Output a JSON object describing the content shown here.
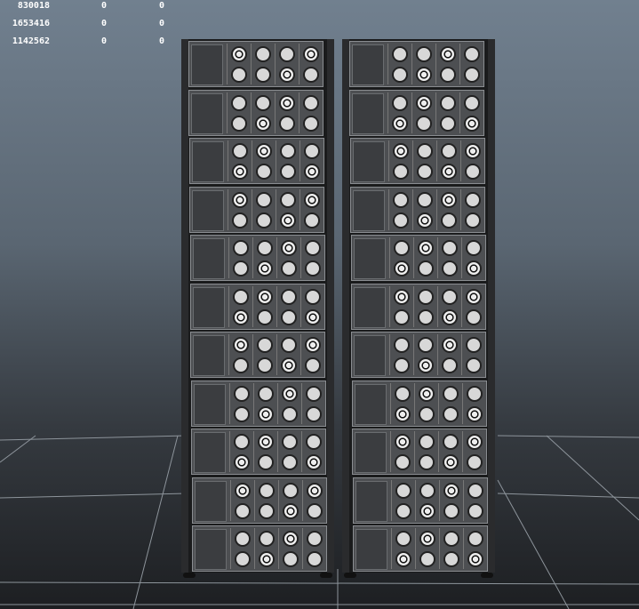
{
  "hud": {
    "rows": [
      {
        "a": "830018",
        "b": "0",
        "c": "0"
      },
      {
        "a": "1653416",
        "b": "0",
        "c": "0"
      },
      {
        "a": "1142562",
        "b": "0",
        "c": "0"
      }
    ]
  },
  "scene": {
    "racks": 2,
    "units_per_rack": 11,
    "fans_per_unit": 8
  },
  "colors": {
    "bg_top": "#71808f",
    "bg_bottom": "#1d1f22",
    "grid": "#9aa0a6",
    "rack": "#1a1b1c"
  }
}
